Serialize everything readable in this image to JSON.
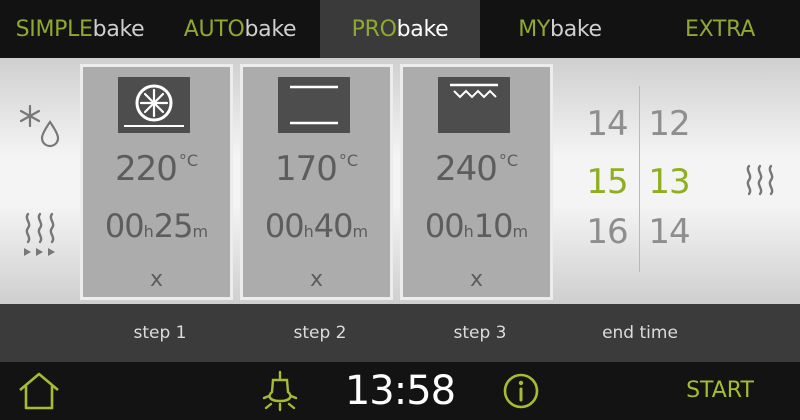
{
  "tabs": [
    {
      "prefix": "SIMPLE",
      "suffix": "bake",
      "active": false
    },
    {
      "prefix": "AUTO",
      "suffix": "bake",
      "active": false
    },
    {
      "prefix": "PRO",
      "suffix": "bake",
      "active": true
    },
    {
      "prefix": "MY",
      "suffix": "bake",
      "active": false
    },
    {
      "prefix": "EXTRA",
      "suffix": "",
      "active": false
    }
  ],
  "left_icons": [
    "defrost-icon",
    "steam-heat-icon"
  ],
  "right_icons": [
    "steam-icon"
  ],
  "steps": [
    {
      "label": "step 1",
      "icon": "fan-heating-icon",
      "temperature": "220",
      "temp_unit": "°C",
      "hours": "00",
      "hours_unit": "h",
      "minutes": "25",
      "minutes_unit": "m",
      "cancel": "x"
    },
    {
      "label": "step 2",
      "icon": "top-bottom-heating-icon",
      "temperature": "170",
      "temp_unit": "°C",
      "hours": "00",
      "hours_unit": "h",
      "minutes": "40",
      "minutes_unit": "m",
      "cancel": "x"
    },
    {
      "label": "step 3",
      "icon": "grill-icon",
      "temperature": "240",
      "temp_unit": "°C",
      "hours": "00",
      "hours_unit": "h",
      "minutes": "10",
      "minutes_unit": "m",
      "cancel": "x"
    }
  ],
  "end_time": {
    "label": "end time",
    "hours": [
      "14",
      "15",
      "16"
    ],
    "minutes": [
      "12",
      "13",
      "14"
    ],
    "selected_hour": "15",
    "selected_minute": "13"
  },
  "bottom": {
    "clock": "13:58",
    "start": "START",
    "icons": [
      "home-icon",
      "lamp-icon",
      "info-icon"
    ]
  },
  "colors": {
    "accent": "#8fae22",
    "card": "#acacac",
    "label_bar": "#3b3b3b"
  }
}
